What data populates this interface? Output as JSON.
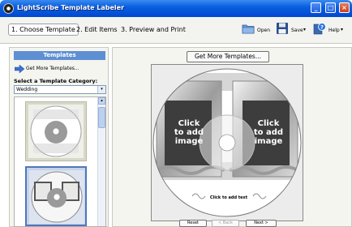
{
  "window": {
    "title": "LightScribe Template Labeler",
    "controls": [
      "_",
      "□",
      "×"
    ]
  },
  "steps": [
    {
      "label": "1. Choose Template"
    },
    {
      "label": "2. Edit Items"
    },
    {
      "label": "3. Preview and Print"
    }
  ],
  "toolbar": {
    "open_label": "Open",
    "save_label": "Save",
    "help_label": "Help",
    "dropdown_glyph": "▾"
  },
  "sidebar": {
    "header": "Templates",
    "get_more_link": "Get More Templates...",
    "category_label": "Select a Template Category:",
    "category_value": "Wedding",
    "scroll_up": "▴"
  },
  "workspace": {
    "get_more_button": "Get More Templates...",
    "disc_text": {
      "left_image": [
        "Click",
        "to add",
        "image"
      ],
      "right_image": [
        "Click",
        "to add",
        "image"
      ],
      "text_field": "Click to add text"
    }
  },
  "nav": {
    "reset": "Reset",
    "back": "< Back",
    "next": "Next >"
  },
  "colors": {
    "titlebar": "#0a5fe0",
    "panel_header": "#5f8fd3",
    "selection": "#5077b8"
  }
}
